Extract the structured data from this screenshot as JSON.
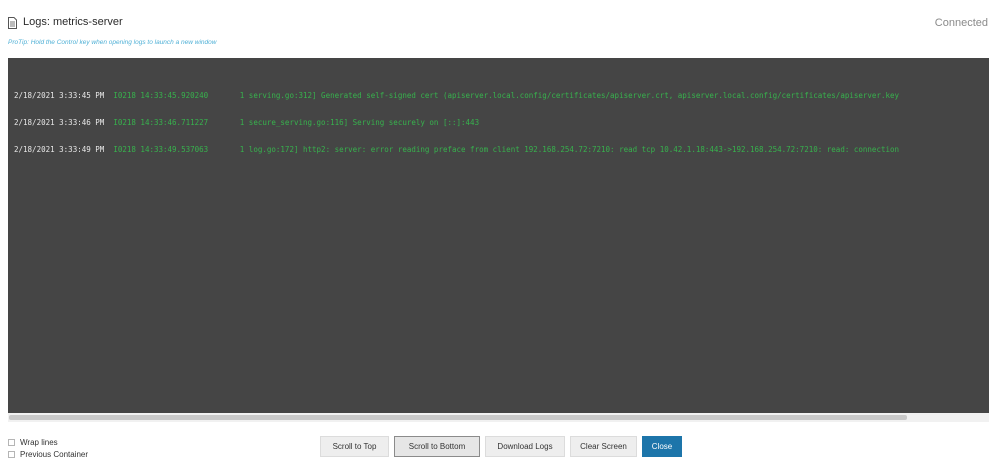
{
  "header": {
    "title": "Logs: metrics-server",
    "status": "Connected",
    "protip": "ProTip: Hold the Control key when opening logs to launch a new window"
  },
  "logs": [
    {
      "timestamp": "2/18/2021 3:33:45 PM",
      "message": "I0218 14:33:45.920240       1 serving.go:312] Generated self-signed cert (apiserver.local.config/certificates/apiserver.crt, apiserver.local.config/certificates/apiserver.key"
    },
    {
      "timestamp": "2/18/2021 3:33:46 PM",
      "message": "I0218 14:33:46.711227       1 secure_serving.go:116] Serving securely on [::]:443"
    },
    {
      "timestamp": "2/18/2021 3:33:49 PM",
      "message": "I0218 14:33:49.537063       1 log.go:172] http2: server: error reading preface from client 192.168.254.72:7210: read tcp 10.42.1.18:443->192.168.254.72:7210: read: connection"
    }
  ],
  "options": {
    "wrap_lines": "Wrap lines",
    "previous_container": "Previous Container"
  },
  "buttons": {
    "scroll_top": "Scroll to Top",
    "scroll_bottom": "Scroll to Bottom",
    "download": "Download Logs",
    "clear": "Clear Screen",
    "close": "Close"
  },
  "colors": {
    "panel_bg": "#454545",
    "log_text": "#37b24d",
    "timestamp_text": "#e8e8e8",
    "primary_button": "#1d75aa",
    "protip_text": "#4fb0d6"
  }
}
